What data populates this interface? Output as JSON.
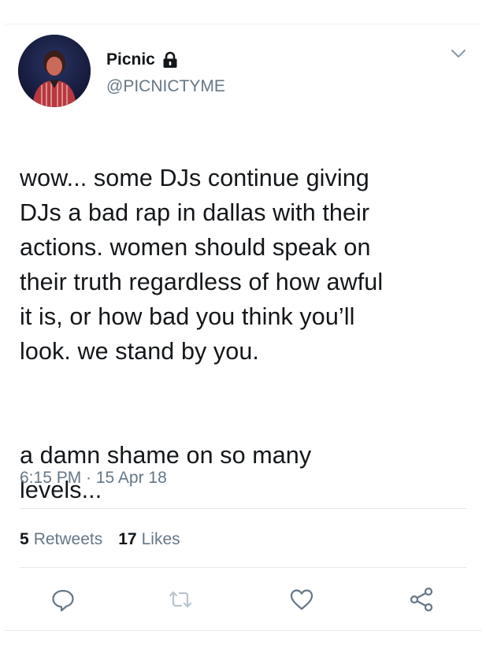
{
  "tweet": {
    "display_name": "Picnic",
    "handle": "@PICNICTYME",
    "text_paragraphs": [
      "wow... some DJs continue giving\nDJs a bad rap in dallas with their\nactions. women should speak on\ntheir truth regardless of how awful\nit is, or how bad you think you’ll\nlook. we stand by you.",
      "a damn shame on so many\nlevels..."
    ],
    "timestamp": "6:15 PM · 15 Apr 18",
    "retweets_count": "5",
    "retweets_label": "Retweets",
    "likes_count": "17",
    "likes_label": "Likes"
  },
  "icons": {
    "lock": "lock-icon",
    "more": "chevron-down-icon",
    "reply": "reply-icon",
    "retweet": "retweet-icon",
    "like": "heart-icon",
    "share": "share-icon"
  },
  "colors": {
    "text_primary": "#14171a",
    "text_secondary": "#657786",
    "icon_gray": "#657786",
    "divider": "#e1e8ed"
  }
}
